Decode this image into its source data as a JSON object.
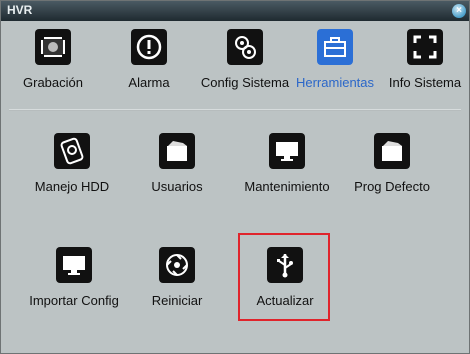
{
  "window": {
    "title": "HVR",
    "close_icon": "close-icon"
  },
  "top_menu": [
    {
      "label": "Grabación",
      "icon": "film-record-icon"
    },
    {
      "label": "Alarma",
      "icon": "alarm-icon"
    },
    {
      "label": "Config Sistema",
      "icon": "gears-icon"
    },
    {
      "label": "Herramientas",
      "icon": "toolbox-icon",
      "active": true
    },
    {
      "label": "Info Sistema",
      "icon": "expand-icon"
    }
  ],
  "tools": [
    {
      "label": "Manejo HDD",
      "icon": "hdd-icon"
    },
    {
      "label": "Usuarios",
      "icon": "folder-icon"
    },
    {
      "label": "Mantenimiento",
      "icon": "monitor-icon"
    },
    {
      "label": "Prog Defecto",
      "icon": "folder-icon"
    },
    {
      "label": "Importar Config",
      "icon": "monitor-icon"
    },
    {
      "label": "Reiniciar",
      "icon": "restart-icon"
    },
    {
      "label": "Actualizar",
      "icon": "usb-icon",
      "highlighted": true
    }
  ],
  "colors": {
    "active": "#2b67c9",
    "highlight": "#e0242c",
    "background": "#bcc3c4"
  }
}
